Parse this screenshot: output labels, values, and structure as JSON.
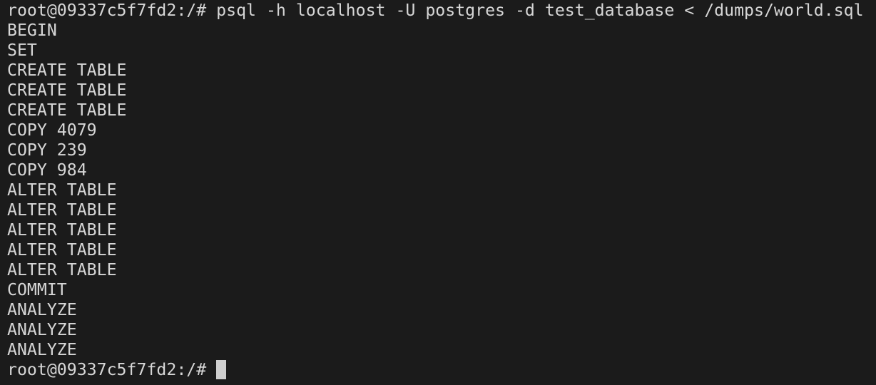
{
  "terminal": {
    "prompt": "root@09337c5f7fd2:/# ",
    "command": "psql -h localhost -U postgres -d test_database < /dumps/world.sql",
    "output": [
      "BEGIN",
      "SET",
      "CREATE TABLE",
      "CREATE TABLE",
      "CREATE TABLE",
      "COPY 4079",
      "COPY 239",
      "COPY 984",
      "ALTER TABLE",
      "ALTER TABLE",
      "ALTER TABLE",
      "ALTER TABLE",
      "ALTER TABLE",
      "COMMIT",
      "ANALYZE",
      "ANALYZE",
      "ANALYZE"
    ],
    "final_prompt": "root@09337c5f7fd2:/# "
  },
  "colors": {
    "background": "#1b1b1b",
    "foreground": "#d6d6d6",
    "cursor": "#cfcfcf"
  }
}
